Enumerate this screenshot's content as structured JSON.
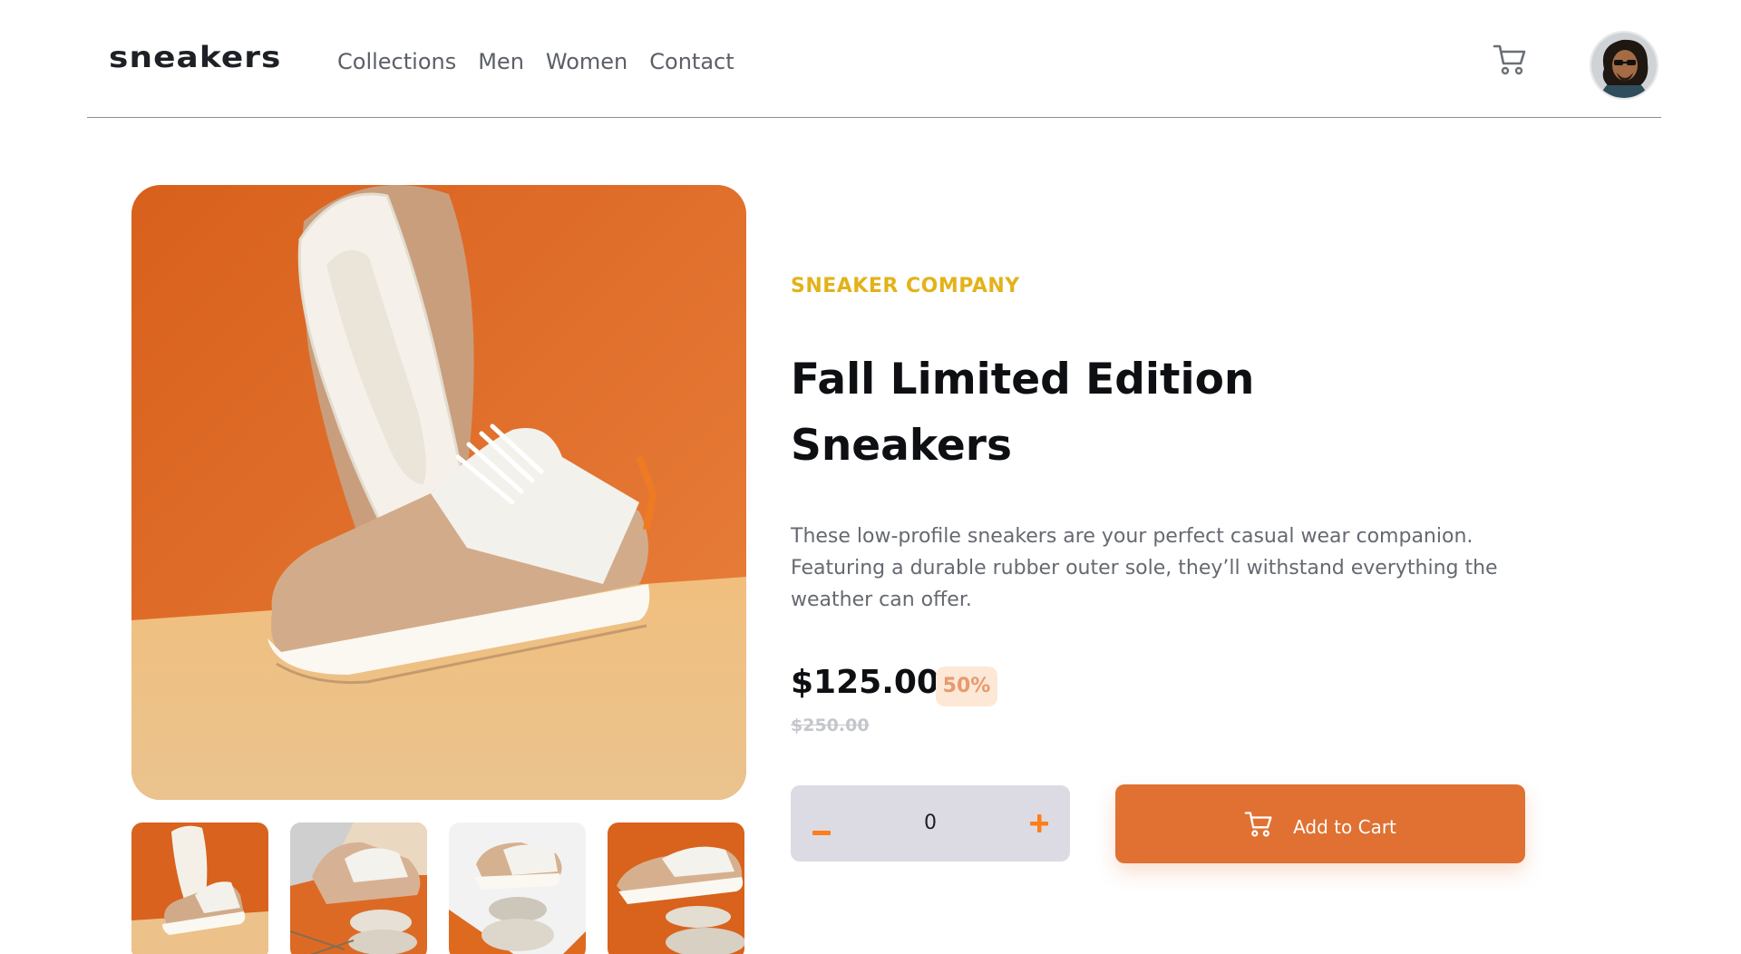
{
  "header": {
    "logo": "sneakers",
    "nav": [
      "Collections",
      "Men",
      "Women",
      "Contact"
    ],
    "cart_icon": "cart-icon",
    "avatar_icon": "avatar-icon"
  },
  "gallery": {
    "thumbnail_count": 4,
    "active_thumbnail": 1
  },
  "product": {
    "company": "SNEAKER COMPANY",
    "title": "Fall Limited Edition Sneakers",
    "description": "These low-profile sneakers are your perfect casual wear companion. Featuring a durable rubber outer sole, they’ll withstand everything the weather can offer.",
    "price": "$125.00",
    "discount": "50%",
    "original_price": "$250.00"
  },
  "cart_controls": {
    "minus_label": "−",
    "quantity": "0",
    "plus_label": "+",
    "add_to_cart_label": "Add to Cart",
    "add_to_cart_icon": "cart-icon"
  },
  "colors": {
    "accent": "#e07132",
    "accent_light": "#fde8d7",
    "company": "#e3b21a",
    "stepper_bg": "#dcdbe4",
    "text_dark": "#0d0f12",
    "text_muted": "#656970",
    "image_orange": "#d9621c",
    "image_sand": "#e9c08a"
  }
}
